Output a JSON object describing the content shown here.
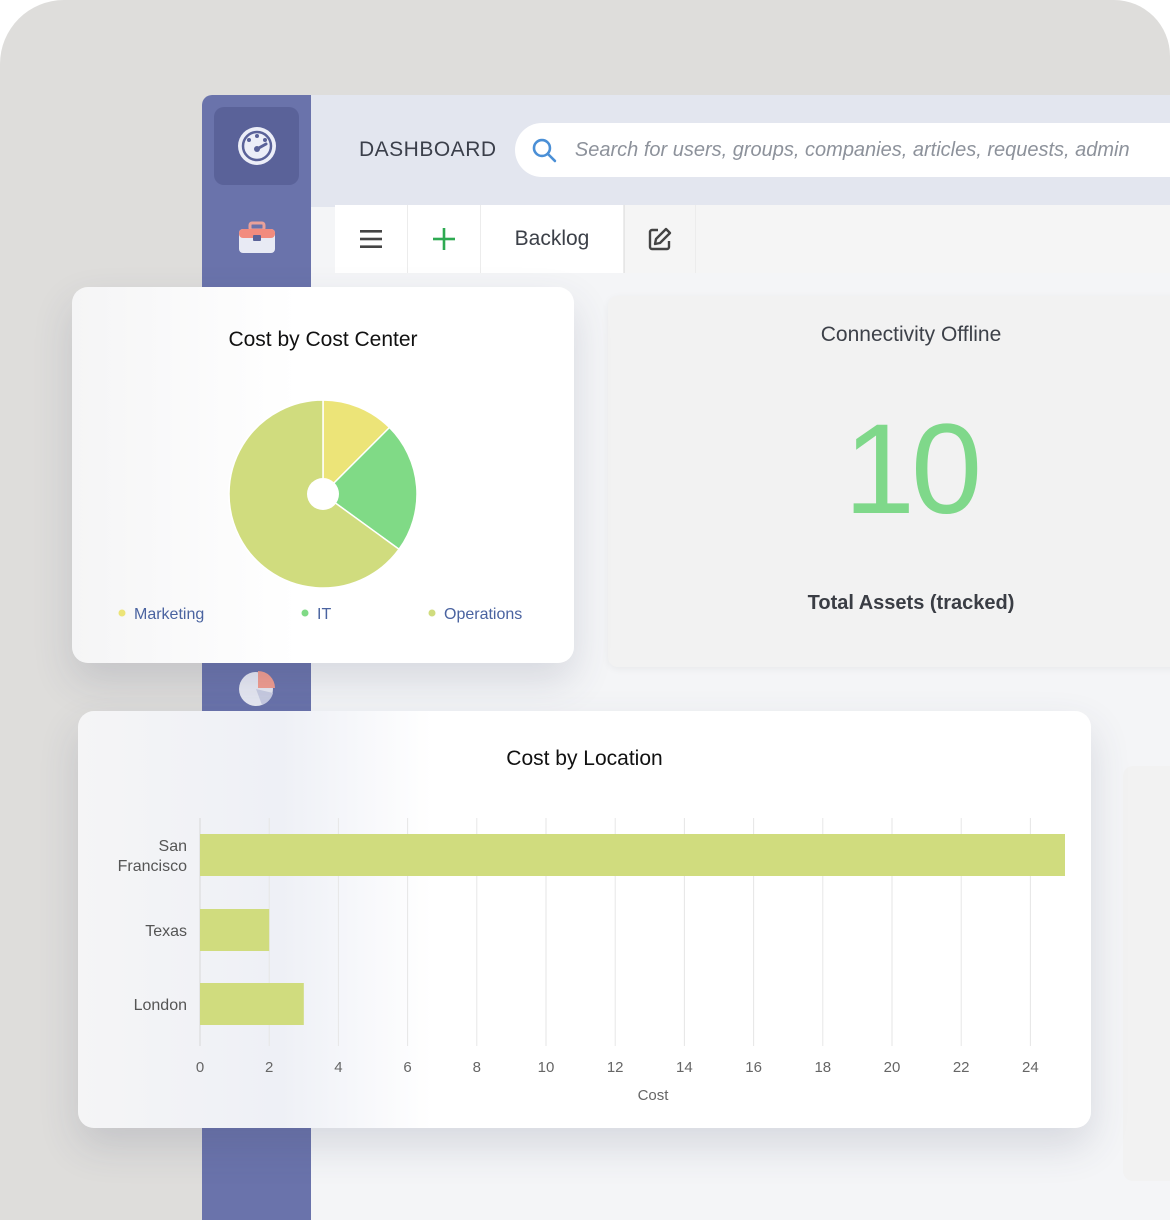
{
  "header": {
    "title": "DASHBOARD",
    "search_placeholder": "Search for users, groups, companies, articles, requests, admin"
  },
  "toolbar": {
    "tab_label": "Backlog"
  },
  "sidebar": {
    "items": [
      {
        "icon": "dashboard-gauge-icon",
        "active": true
      },
      {
        "icon": "briefcase-icon",
        "active": false
      },
      {
        "icon": "pie-chart-icon",
        "active": false
      }
    ]
  },
  "kpi": {
    "title": "Connectivity Offline",
    "value": "10",
    "subtitle": "Total Assets (tracked)",
    "color": "#7fd88a"
  },
  "chart_data": [
    {
      "type": "pie",
      "title": "Cost by Cost Center",
      "categories": [
        "Marketing",
        "IT",
        "Operations"
      ],
      "values": [
        12.5,
        22.5,
        65
      ],
      "colors": [
        "#ece478",
        "#80da86",
        "#d0dc7e"
      ],
      "legend": "bottom"
    },
    {
      "type": "bar",
      "orientation": "horizontal",
      "title": "Cost by Location",
      "categories": [
        "San Francisco",
        "Texas",
        "London"
      ],
      "category_lines": [
        [
          "San",
          "Francisco"
        ],
        [
          "Texas"
        ],
        [
          "London"
        ]
      ],
      "values": [
        25,
        2,
        3
      ],
      "xlabel": "Cost",
      "ylabel": "",
      "xlim": [
        0,
        25
      ],
      "xticks": [
        0,
        2,
        4,
        6,
        8,
        10,
        12,
        14,
        16,
        18,
        20,
        22,
        24
      ],
      "grid": true,
      "color": "#d0dc7e"
    }
  ]
}
